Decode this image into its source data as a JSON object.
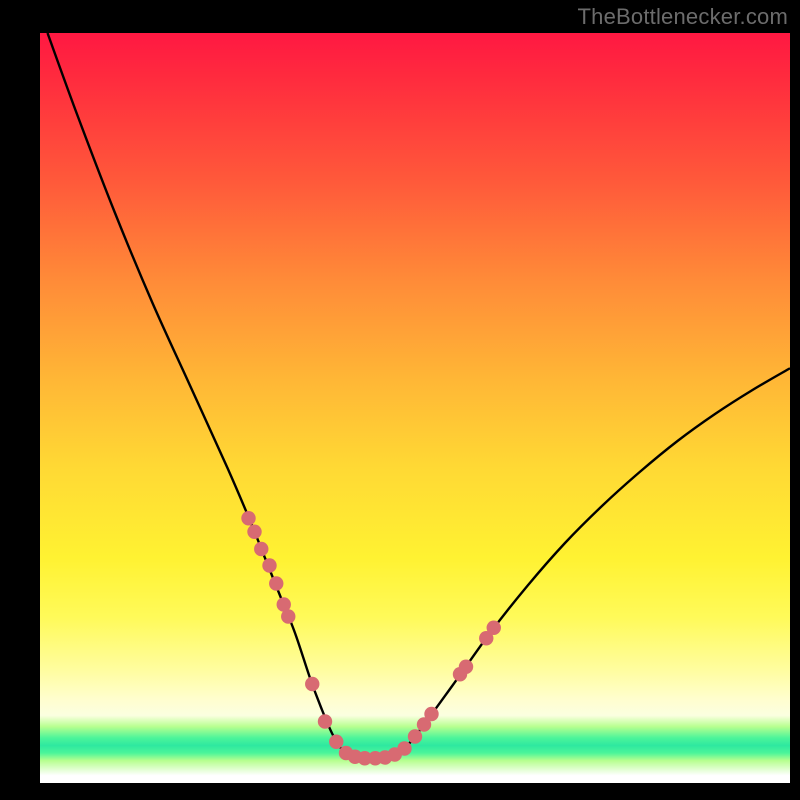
{
  "watermark": "TheBottlenecker.com",
  "colors": {
    "curve": "#000000",
    "points": "#d86a72",
    "frame": "#000000"
  },
  "chart_data": {
    "type": "line",
    "title": "",
    "xlabel": "",
    "ylabel": "",
    "xlim": [
      0,
      100
    ],
    "ylim": [
      0,
      100
    ],
    "series": [
      {
        "name": "curve",
        "x": [
          1,
          5,
          10,
          15,
          20,
          25,
          28,
          30,
          32,
          34,
          36,
          37.5,
          39,
          40.5,
          42,
          44,
          46,
          48,
          50,
          55,
          60,
          65,
          70,
          75,
          80,
          85,
          90,
          95,
          100
        ],
        "y": [
          100,
          89,
          76,
          64,
          53,
          42,
          35,
          30,
          25,
          20,
          14,
          10,
          6.5,
          4.2,
          3.5,
          3.3,
          3.4,
          4.2,
          6.2,
          13,
          20,
          26.3,
          32,
          37,
          41.5,
          45.6,
          49.2,
          52.4,
          55.3
        ]
      }
    ],
    "scatter_points": {
      "name": "beads",
      "x": [
        27.8,
        28.6,
        29.5,
        30.6,
        31.5,
        32.5,
        33.1,
        36.3,
        38.0,
        39.5,
        40.8,
        42.0,
        43.3,
        44.7,
        46.0,
        47.3,
        48.6,
        50.0,
        51.2,
        52.2,
        56.0,
        56.8,
        59.5,
        60.5
      ],
      "y": [
        35.3,
        33.5,
        31.2,
        29.0,
        26.6,
        23.8,
        22.2,
        13.2,
        8.2,
        5.5,
        4.0,
        3.5,
        3.3,
        3.3,
        3.4,
        3.8,
        4.6,
        6.2,
        7.8,
        9.2,
        14.5,
        15.5,
        19.3,
        20.7
      ]
    },
    "gradient_description": "vertical red-to-green gradient background where green band near bottom indicates optimal (no bottleneck), curve minimum sits in green band"
  }
}
